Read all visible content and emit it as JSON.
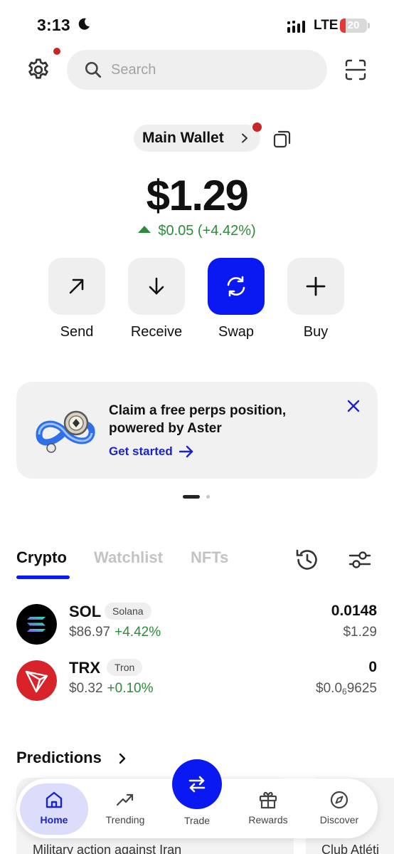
{
  "status_bar": {
    "time": "3:13",
    "network": "LTE",
    "battery": "20",
    "battery_level": 0.2
  },
  "header": {
    "search_placeholder": "Search",
    "has_notification": true
  },
  "wallet": {
    "name": "Main Wallet",
    "balance": "$1.29",
    "change": "$0.05 (+4.42%)"
  },
  "actions": [
    {
      "label": "Send",
      "icon": "arrow-up-right-icon"
    },
    {
      "label": "Receive",
      "icon": "arrow-down-icon"
    },
    {
      "label": "Swap",
      "icon": "swap-icon"
    },
    {
      "label": "Buy",
      "icon": "plus-icon"
    }
  ],
  "promo": {
    "title": "Claim a free perps position, powered by Aster",
    "cta": "Get started"
  },
  "tabs": [
    "Crypto",
    "Watchlist",
    "NFTs"
  ],
  "assets": [
    {
      "symbol": "SOL",
      "name": "Solana",
      "price": "$86.97",
      "change": "+4.42%",
      "amount": "0.0148",
      "value": "$1.29"
    },
    {
      "symbol": "TRX",
      "name": "Tron",
      "price": "$0.32",
      "change": "+0.10%",
      "amount": "0",
      "value_prefix": "$0.0",
      "value_sub": "6",
      "value_suffix": "9625"
    }
  ],
  "predictions": {
    "title": "Predictions",
    "cards": [
      "Military action against Iran",
      "Club Atléti"
    ]
  },
  "nav": {
    "items": [
      "Home",
      "Trending",
      "Trade",
      "Rewards",
      "Discover"
    ],
    "active": "Home"
  },
  "colors": {
    "accent": "#0a19f2",
    "positive": "#2e8b3a",
    "badge_red": "#c62828"
  }
}
